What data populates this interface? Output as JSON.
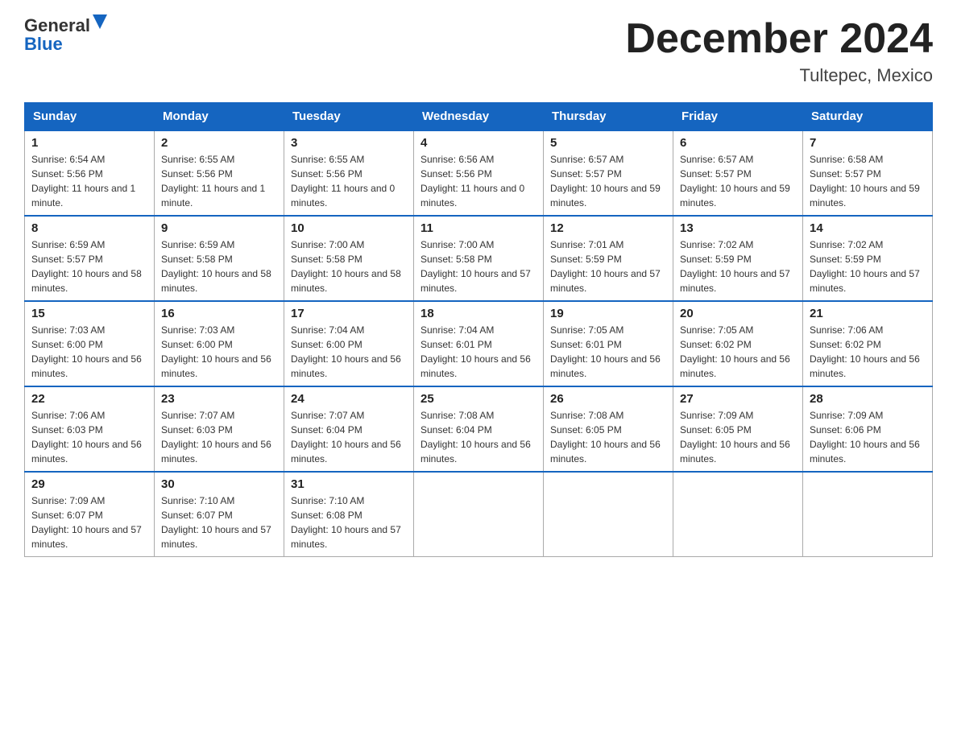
{
  "header": {
    "logo_general": "General",
    "logo_blue": "Blue",
    "title": "December 2024",
    "location": "Tultepec, Mexico"
  },
  "days_of_week": [
    "Sunday",
    "Monday",
    "Tuesday",
    "Wednesday",
    "Thursday",
    "Friday",
    "Saturday"
  ],
  "weeks": [
    [
      {
        "day": "1",
        "sunrise": "Sunrise: 6:54 AM",
        "sunset": "Sunset: 5:56 PM",
        "daylight": "Daylight: 11 hours and 1 minute."
      },
      {
        "day": "2",
        "sunrise": "Sunrise: 6:55 AM",
        "sunset": "Sunset: 5:56 PM",
        "daylight": "Daylight: 11 hours and 1 minute."
      },
      {
        "day": "3",
        "sunrise": "Sunrise: 6:55 AM",
        "sunset": "Sunset: 5:56 PM",
        "daylight": "Daylight: 11 hours and 0 minutes."
      },
      {
        "day": "4",
        "sunrise": "Sunrise: 6:56 AM",
        "sunset": "Sunset: 5:56 PM",
        "daylight": "Daylight: 11 hours and 0 minutes."
      },
      {
        "day": "5",
        "sunrise": "Sunrise: 6:57 AM",
        "sunset": "Sunset: 5:57 PM",
        "daylight": "Daylight: 10 hours and 59 minutes."
      },
      {
        "day": "6",
        "sunrise": "Sunrise: 6:57 AM",
        "sunset": "Sunset: 5:57 PM",
        "daylight": "Daylight: 10 hours and 59 minutes."
      },
      {
        "day": "7",
        "sunrise": "Sunrise: 6:58 AM",
        "sunset": "Sunset: 5:57 PM",
        "daylight": "Daylight: 10 hours and 59 minutes."
      }
    ],
    [
      {
        "day": "8",
        "sunrise": "Sunrise: 6:59 AM",
        "sunset": "Sunset: 5:57 PM",
        "daylight": "Daylight: 10 hours and 58 minutes."
      },
      {
        "day": "9",
        "sunrise": "Sunrise: 6:59 AM",
        "sunset": "Sunset: 5:58 PM",
        "daylight": "Daylight: 10 hours and 58 minutes."
      },
      {
        "day": "10",
        "sunrise": "Sunrise: 7:00 AM",
        "sunset": "Sunset: 5:58 PM",
        "daylight": "Daylight: 10 hours and 58 minutes."
      },
      {
        "day": "11",
        "sunrise": "Sunrise: 7:00 AM",
        "sunset": "Sunset: 5:58 PM",
        "daylight": "Daylight: 10 hours and 57 minutes."
      },
      {
        "day": "12",
        "sunrise": "Sunrise: 7:01 AM",
        "sunset": "Sunset: 5:59 PM",
        "daylight": "Daylight: 10 hours and 57 minutes."
      },
      {
        "day": "13",
        "sunrise": "Sunrise: 7:02 AM",
        "sunset": "Sunset: 5:59 PM",
        "daylight": "Daylight: 10 hours and 57 minutes."
      },
      {
        "day": "14",
        "sunrise": "Sunrise: 7:02 AM",
        "sunset": "Sunset: 5:59 PM",
        "daylight": "Daylight: 10 hours and 57 minutes."
      }
    ],
    [
      {
        "day": "15",
        "sunrise": "Sunrise: 7:03 AM",
        "sunset": "Sunset: 6:00 PM",
        "daylight": "Daylight: 10 hours and 56 minutes."
      },
      {
        "day": "16",
        "sunrise": "Sunrise: 7:03 AM",
        "sunset": "Sunset: 6:00 PM",
        "daylight": "Daylight: 10 hours and 56 minutes."
      },
      {
        "day": "17",
        "sunrise": "Sunrise: 7:04 AM",
        "sunset": "Sunset: 6:00 PM",
        "daylight": "Daylight: 10 hours and 56 minutes."
      },
      {
        "day": "18",
        "sunrise": "Sunrise: 7:04 AM",
        "sunset": "Sunset: 6:01 PM",
        "daylight": "Daylight: 10 hours and 56 minutes."
      },
      {
        "day": "19",
        "sunrise": "Sunrise: 7:05 AM",
        "sunset": "Sunset: 6:01 PM",
        "daylight": "Daylight: 10 hours and 56 minutes."
      },
      {
        "day": "20",
        "sunrise": "Sunrise: 7:05 AM",
        "sunset": "Sunset: 6:02 PM",
        "daylight": "Daylight: 10 hours and 56 minutes."
      },
      {
        "day": "21",
        "sunrise": "Sunrise: 7:06 AM",
        "sunset": "Sunset: 6:02 PM",
        "daylight": "Daylight: 10 hours and 56 minutes."
      }
    ],
    [
      {
        "day": "22",
        "sunrise": "Sunrise: 7:06 AM",
        "sunset": "Sunset: 6:03 PM",
        "daylight": "Daylight: 10 hours and 56 minutes."
      },
      {
        "day": "23",
        "sunrise": "Sunrise: 7:07 AM",
        "sunset": "Sunset: 6:03 PM",
        "daylight": "Daylight: 10 hours and 56 minutes."
      },
      {
        "day": "24",
        "sunrise": "Sunrise: 7:07 AM",
        "sunset": "Sunset: 6:04 PM",
        "daylight": "Daylight: 10 hours and 56 minutes."
      },
      {
        "day": "25",
        "sunrise": "Sunrise: 7:08 AM",
        "sunset": "Sunset: 6:04 PM",
        "daylight": "Daylight: 10 hours and 56 minutes."
      },
      {
        "day": "26",
        "sunrise": "Sunrise: 7:08 AM",
        "sunset": "Sunset: 6:05 PM",
        "daylight": "Daylight: 10 hours and 56 minutes."
      },
      {
        "day": "27",
        "sunrise": "Sunrise: 7:09 AM",
        "sunset": "Sunset: 6:05 PM",
        "daylight": "Daylight: 10 hours and 56 minutes."
      },
      {
        "day": "28",
        "sunrise": "Sunrise: 7:09 AM",
        "sunset": "Sunset: 6:06 PM",
        "daylight": "Daylight: 10 hours and 56 minutes."
      }
    ],
    [
      {
        "day": "29",
        "sunrise": "Sunrise: 7:09 AM",
        "sunset": "Sunset: 6:07 PM",
        "daylight": "Daylight: 10 hours and 57 minutes."
      },
      {
        "day": "30",
        "sunrise": "Sunrise: 7:10 AM",
        "sunset": "Sunset: 6:07 PM",
        "daylight": "Daylight: 10 hours and 57 minutes."
      },
      {
        "day": "31",
        "sunrise": "Sunrise: 7:10 AM",
        "sunset": "Sunset: 6:08 PM",
        "daylight": "Daylight: 10 hours and 57 minutes."
      },
      null,
      null,
      null,
      null
    ]
  ]
}
